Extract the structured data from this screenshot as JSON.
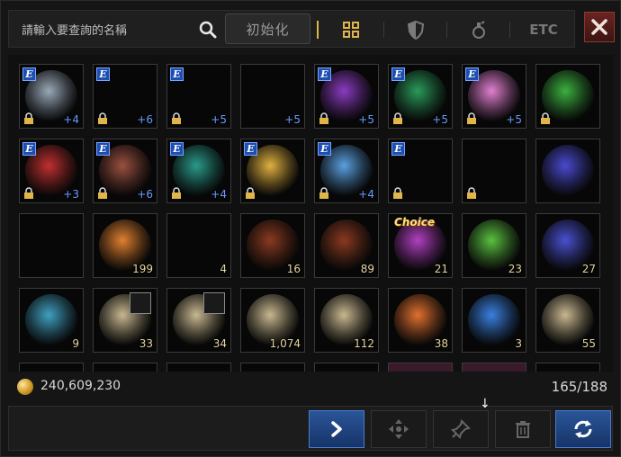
{
  "search": {
    "placeholder": "請輸入要查詢的名稱"
  },
  "reset_label": "初始化",
  "tabs": [
    {
      "name": "all",
      "icon": "grid-icon",
      "active": true
    },
    {
      "name": "equipment",
      "icon": "shield-icon",
      "active": false
    },
    {
      "name": "consumable",
      "icon": "potion-icon",
      "active": false
    },
    {
      "name": "etc",
      "label": "ETC",
      "active": false
    }
  ],
  "gold": "240,609,230",
  "capacity": "165/188",
  "colors": {
    "accent": "#e0b54a",
    "badge_blue": "#1d4fb0",
    "action_blue": "#2a5598",
    "close_red": "#6a2420"
  },
  "items": [
    {
      "icon": "mask-icon",
      "e": true,
      "locked": true,
      "enh": "+4",
      "qty": ""
    },
    {
      "icon": "earring-red-icon",
      "e": true,
      "locked": true,
      "enh": "+6",
      "qty": ""
    },
    {
      "icon": "earring-white-icon",
      "e": true,
      "locked": true,
      "enh": "+5",
      "qty": ""
    },
    {
      "icon": "earring-silver-icon",
      "e": false,
      "locked": false,
      "enh": "+5",
      "qty": ""
    },
    {
      "icon": "emblem-purple-icon",
      "e": true,
      "locked": true,
      "enh": "+5",
      "qty": ""
    },
    {
      "icon": "emblem-green-icon",
      "e": true,
      "locked": true,
      "enh": "+5",
      "qty": ""
    },
    {
      "icon": "ring-pink-icon",
      "e": true,
      "locked": true,
      "enh": "+5",
      "qty": ""
    },
    {
      "icon": "ring-green-icon",
      "e": false,
      "locked": true,
      "enh": "",
      "qty": ""
    },
    {
      "icon": "ring-red-icon",
      "e": true,
      "locked": true,
      "enh": "+3",
      "qty": ""
    },
    {
      "icon": "rune-tablet-red-icon",
      "e": true,
      "locked": true,
      "enh": "+6",
      "qty": ""
    },
    {
      "icon": "rune-tablet-teal-icon",
      "e": true,
      "locked": true,
      "enh": "+4",
      "qty": ""
    },
    {
      "icon": "ring-gold-icon",
      "e": true,
      "locked": true,
      "enh": "",
      "qty": ""
    },
    {
      "icon": "necklace-blue-icon",
      "e": true,
      "locked": true,
      "enh": "+4",
      "qty": ""
    },
    {
      "icon": "belt-icon",
      "e": true,
      "locked": true,
      "enh": "",
      "qty": ""
    },
    {
      "icon": "skull-necklace-icon",
      "e": false,
      "locked": true,
      "enh": "",
      "qty": ""
    },
    {
      "icon": "upgrade-shield-icon",
      "e": false,
      "locked": false,
      "enh": "",
      "qty": ""
    },
    {
      "icon": "helmet-icon",
      "e": false,
      "locked": false,
      "enh": "",
      "qty": ""
    },
    {
      "icon": "chest-orange-icon",
      "e": false,
      "locked": false,
      "enh": "",
      "qty": "199"
    },
    {
      "icon": "chest-silver-icon",
      "e": false,
      "locked": false,
      "enh": "",
      "qty": "4"
    },
    {
      "icon": "chest-leaf-icon",
      "e": false,
      "locked": false,
      "enh": "",
      "qty": "16"
    },
    {
      "icon": "chest-leaf-icon",
      "e": false,
      "locked": false,
      "enh": "",
      "qty": "89"
    },
    {
      "icon": "choice-box-icon",
      "e": false,
      "locked": false,
      "enh": "",
      "qty": "21",
      "choice": "Choice"
    },
    {
      "icon": "potion-green-icon",
      "e": false,
      "locked": false,
      "enh": "",
      "qty": "23"
    },
    {
      "icon": "potion-blue-icon",
      "e": false,
      "locked": false,
      "enh": "",
      "qty": "27"
    },
    {
      "icon": "vial-cyan-icon",
      "e": false,
      "locked": false,
      "enh": "",
      "qty": "9"
    },
    {
      "icon": "rune-scroll-icon",
      "e": false,
      "locked": false,
      "enh": "",
      "qty": "33",
      "overlay": true
    },
    {
      "icon": "rune-scroll-icon",
      "e": false,
      "locked": false,
      "enh": "",
      "qty": "34",
      "overlay": true
    },
    {
      "icon": "sword-scroll-icon",
      "e": false,
      "locked": false,
      "enh": "",
      "qty": "1,074"
    },
    {
      "icon": "shield-scroll-icon",
      "e": false,
      "locked": false,
      "enh": "",
      "qty": "112"
    },
    {
      "icon": "orange-vial-icon",
      "e": false,
      "locked": false,
      "enh": "",
      "qty": "38"
    },
    {
      "icon": "blue-map-icon",
      "e": false,
      "locked": false,
      "enh": "",
      "qty": "3"
    },
    {
      "icon": "map-scroll-icon",
      "e": false,
      "locked": false,
      "enh": "",
      "qty": "55"
    }
  ]
}
